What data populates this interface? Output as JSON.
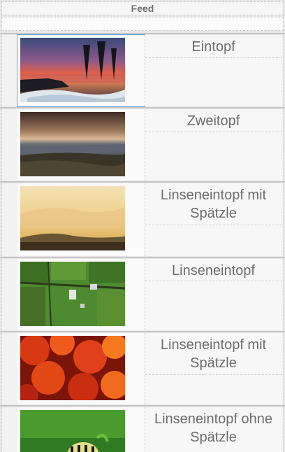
{
  "header": {
    "title": "Feed"
  },
  "feed": {
    "items": [
      {
        "title": "Eintopf",
        "image": "lake-sunset-image"
      },
      {
        "title": "Zweitopf",
        "image": "coast-sunset-image"
      },
      {
        "title": "Linseneintopf mit Spätzle",
        "image": "desert-haze-image"
      },
      {
        "title": "Linseneintopf",
        "image": "green-farmland-image"
      },
      {
        "title": "Linseneintopf mit Spätzle",
        "image": "red-maple-leaves-image"
      },
      {
        "title": "Linseneintopf ohne Spätzle",
        "image": "caterpillar-image"
      }
    ]
  }
}
